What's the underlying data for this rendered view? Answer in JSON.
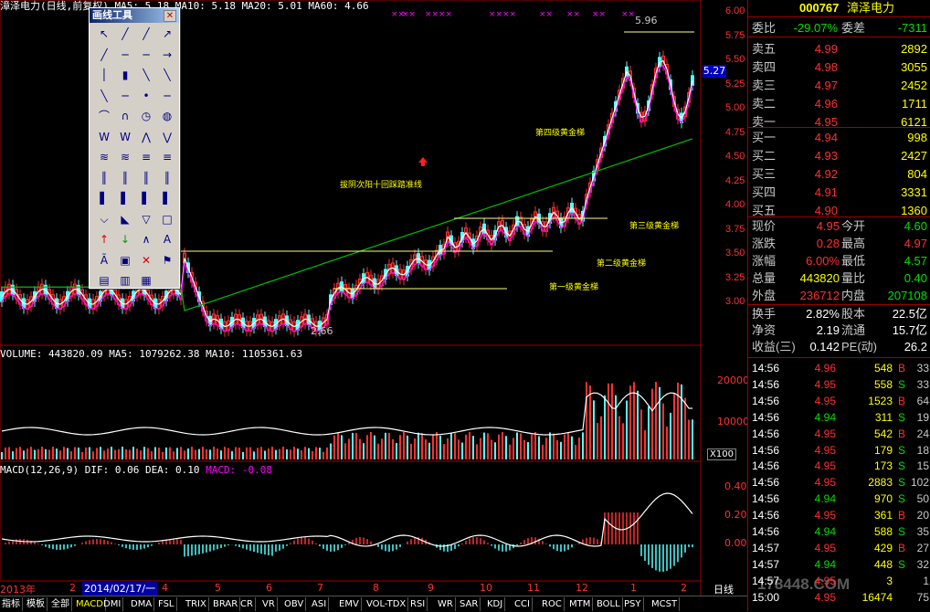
{
  "stock": {
    "code": "000767",
    "name": "漳泽电力",
    "header_price_labels": "漳泽电力(日线,前复权)  MA5: 5.18  MA10: 5.18  MA20: 5.01  MA60: 4.66",
    "chart_type_label": "日线"
  },
  "price_pane": {
    "axis_ticks": [
      "6.00",
      "5.75",
      "5.50",
      "5.25",
      "5.00",
      "4.75",
      "4.50",
      "4.25",
      "4.00",
      "3.75",
      "3.50",
      "3.25",
      "3.00"
    ],
    "current_price_box": "5.27",
    "high_label": "5.96",
    "low_label": "2.66",
    "annotations": {
      "a1": "第一级黄金梯",
      "a2": "第二级黄金梯",
      "a3": "第三级黄金梯",
      "a4": "第四级黄金梯",
      "a5": "拔阴次阳十回踩踏准线"
    }
  },
  "volume_pane": {
    "title": "VOLUME: 443820.09  MA5: 1079262.38  MA10: 1105361.63",
    "axis_ticks": [
      "20000",
      "10000"
    ],
    "unit": "X100"
  },
  "macd_pane": {
    "title_prefix": "MACD(12,26,9)  DIF: 0.06  DEA: 0.10",
    "title_macd": "MACD: -0.08",
    "axis_ticks": [
      "0.40",
      "0.20",
      "0.00"
    ]
  },
  "date_axis": {
    "year_label": "2013年",
    "months": [
      "2",
      "3",
      "4",
      "5",
      "6",
      "7",
      "8",
      "9",
      "10",
      "11",
      "12",
      "1",
      "2"
    ],
    "cursor_date": "2014/02/17/一"
  },
  "toolbox": {
    "title": "画线工具",
    "close": "✕"
  },
  "quote": {
    "weibi_label": "委比",
    "weibi": "-29.07%",
    "weicha_label": "委差",
    "weicha": "-7311",
    "sell": [
      {
        "label": "卖五",
        "price": "4.99",
        "vol": "2892"
      },
      {
        "label": "卖四",
        "price": "4.98",
        "vol": "3055"
      },
      {
        "label": "卖三",
        "price": "4.97",
        "vol": "2452"
      },
      {
        "label": "卖二",
        "price": "4.96",
        "vol": "1711"
      },
      {
        "label": "卖一",
        "price": "4.95",
        "vol": "6121"
      }
    ],
    "buy": [
      {
        "label": "买一",
        "price": "4.94",
        "vol": "998"
      },
      {
        "label": "买二",
        "price": "4.93",
        "vol": "2427"
      },
      {
        "label": "买三",
        "price": "4.92",
        "vol": "804"
      },
      {
        "label": "买四",
        "price": "4.91",
        "vol": "3331"
      },
      {
        "label": "买五",
        "price": "4.90",
        "vol": "1360"
      }
    ],
    "stats": [
      {
        "l1": "现价",
        "v1": "4.95",
        "c1": "#ff3030",
        "l2": "今开",
        "v2": "4.60",
        "c2": "#00e000"
      },
      {
        "l1": "涨跌",
        "v1": "0.28",
        "c1": "#ff3030",
        "l2": "最高",
        "v2": "4.97",
        "c2": "#ff3030"
      },
      {
        "l1": "涨幅",
        "v1": "6.00%",
        "c1": "#ff3030",
        "l2": "最低",
        "v2": "4.57",
        "c2": "#00e000"
      },
      {
        "l1": "总量",
        "v1": "443820",
        "c1": "#ffff00",
        "l2": "量比",
        "v2": "0.40",
        "c2": "#00e000"
      },
      {
        "l1": "外盘",
        "v1": "236712",
        "c1": "#ff3030",
        "l2": "内盘",
        "v2": "207108",
        "c2": "#00e000"
      }
    ],
    "stats2": [
      {
        "l1": "换手",
        "v1": "2.82%",
        "l2": "股本",
        "v2": "22.5亿"
      },
      {
        "l1": "净资",
        "v1": "2.19",
        "l2": "流通",
        "v2": "15.7亿"
      },
      {
        "l1": "收益(三)",
        "v1": "0.142",
        "l2": "PE(动)",
        "v2": "26.2"
      }
    ],
    "ticks": [
      {
        "t": "14:56",
        "p": "4.96",
        "v": "548",
        "bs": "B",
        "n": "33"
      },
      {
        "t": "14:56",
        "p": "4.95",
        "v": "558",
        "bs": "S",
        "n": "33"
      },
      {
        "t": "14:56",
        "p": "4.95",
        "v": "1523",
        "bs": "B",
        "n": "64"
      },
      {
        "t": "14:56",
        "p": "4.94",
        "v": "311",
        "bs": "S",
        "n": "19"
      },
      {
        "t": "14:56",
        "p": "4.95",
        "v": "542",
        "bs": "B",
        "n": "24"
      },
      {
        "t": "14:56",
        "p": "4.95",
        "v": "179",
        "bs": "S",
        "n": "18"
      },
      {
        "t": "14:56",
        "p": "4.95",
        "v": "173",
        "bs": "S",
        "n": "15"
      },
      {
        "t": "14:56",
        "p": "4.95",
        "v": "2883",
        "bs": "S",
        "n": "102"
      },
      {
        "t": "14:56",
        "p": "4.94",
        "v": "970",
        "bs": "S",
        "n": "50"
      },
      {
        "t": "14:56",
        "p": "4.95",
        "v": "361",
        "bs": "B",
        "n": "20"
      },
      {
        "t": "14:56",
        "p": "4.94",
        "v": "588",
        "bs": "S",
        "n": "35"
      },
      {
        "t": "14:57",
        "p": "4.95",
        "v": "429",
        "bs": "B",
        "n": "27"
      },
      {
        "t": "14:57",
        "p": "4.94",
        "v": "448",
        "bs": "S",
        "n": "32"
      },
      {
        "t": "14:57",
        "p": "4.95",
        "v": "3",
        "bs": "",
        "n": "1"
      },
      {
        "t": "15:00",
        "p": "4.95",
        "v": "16474",
        "bs": "",
        "n": "75"
      }
    ]
  },
  "bottom_tabs": [
    "指标",
    "模板",
    "全部",
    "MACD",
    "DMI",
    "DMA",
    "FSL",
    "TRIX",
    "BRAR",
    "CR",
    "VR",
    "OBV",
    "ASI",
    "EMV",
    "VOL-TDX",
    "RSI",
    "WR",
    "SAR",
    "KDJ",
    "CCI",
    "ROC",
    "MTM",
    "BOLL",
    "PSY",
    "MCST"
  ],
  "watermark": "178448.COM",
  "colors": {
    "up": "#ff3030",
    "down": "#54ffff",
    "ma5": "#ffffff",
    "ma10": "#ffff00",
    "ma20": "#ff00ff",
    "ma60": "#00c000",
    "grid": "#a00000"
  }
}
